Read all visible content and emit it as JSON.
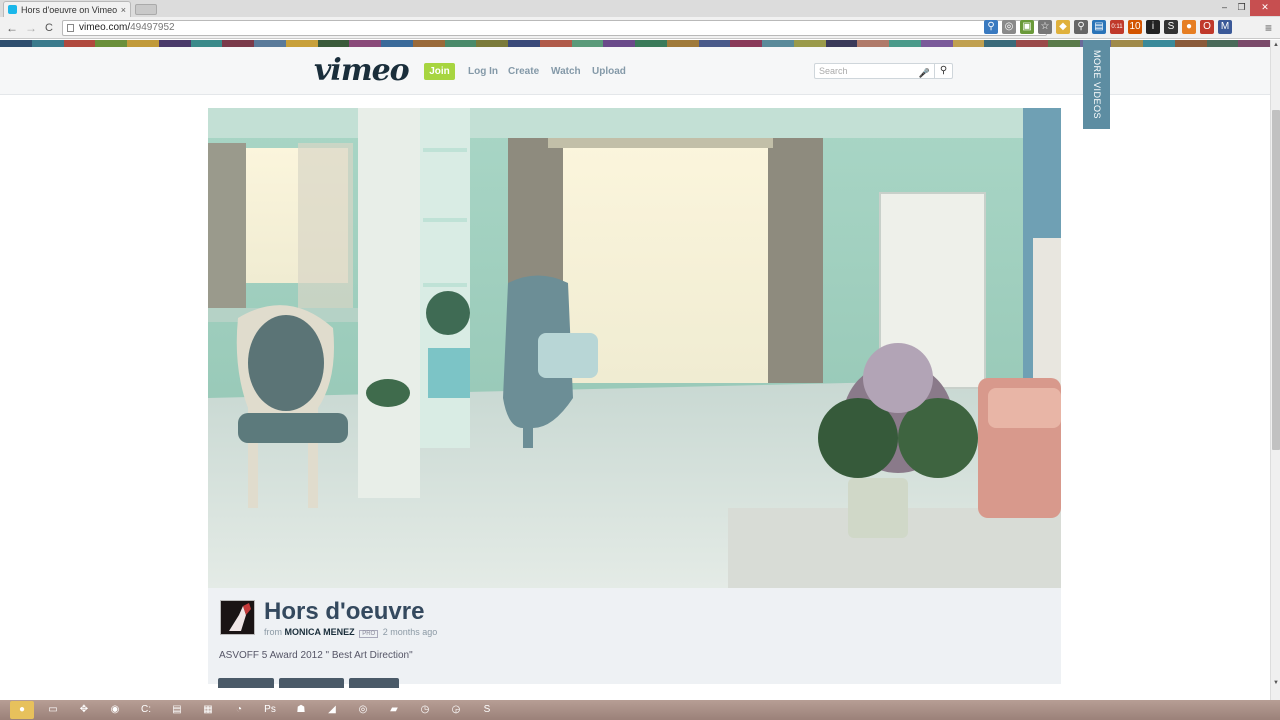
{
  "browser": {
    "tab_title": "Hors d'oeuvre on Vimeo",
    "tab_close": "×",
    "url_host": "vimeo.com/",
    "url_path": "49497952",
    "back": "←",
    "forward": "→",
    "reload": "C",
    "menu": "≡",
    "window": {
      "minimize": "–",
      "restore": "❐",
      "close": "✕"
    },
    "extensions": [
      {
        "name": "translate-icon",
        "glyph": "⚲",
        "color": "#3a7ac0"
      },
      {
        "name": "page-action-icon",
        "glyph": "◎",
        "color": "#8a8a8a"
      },
      {
        "name": "cast-icon",
        "glyph": "▣",
        "color": "#6a9a3a"
      },
      {
        "name": "bookmark-star-icon",
        "glyph": "☆",
        "color": "#777777"
      },
      {
        "name": "ext-folder-icon",
        "glyph": "◆",
        "color": "#e0b13c"
      },
      {
        "name": "ext-search-icon",
        "glyph": "⚲",
        "color": "#666666"
      },
      {
        "name": "ext-screen-icon",
        "glyph": "▤",
        "color": "#2a74b8"
      },
      {
        "name": "ext-counter-icon",
        "glyph": "0:11",
        "color": "#c0392b"
      },
      {
        "name": "ext-badge-icon",
        "glyph": "10",
        "color": "#d35400"
      },
      {
        "name": "ext-info-icon",
        "glyph": "i",
        "color": "#222222"
      },
      {
        "name": "ext-s-icon",
        "glyph": "S",
        "color": "#333333"
      },
      {
        "name": "ext-cookie-icon",
        "glyph": "●",
        "color": "#e67e22"
      },
      {
        "name": "ext-opera-icon",
        "glyph": "O",
        "color": "#c0392b"
      },
      {
        "name": "gmail-icon",
        "glyph": "M",
        "color": "#3b5998"
      }
    ]
  },
  "stripe_colors": [
    "#2e4e6e",
    "#3a7a8c",
    "#b0493e",
    "#6a8f3a",
    "#c19a3a",
    "#4a3a6a",
    "#3a8a8a",
    "#7a3a4a",
    "#5a7a9a",
    "#c8a03a",
    "#3a5a3a",
    "#8a4a7a",
    "#3a6a9a",
    "#9a6a3a",
    "#4a8a6a",
    "#7a7a3a",
    "#3a4a7a",
    "#b05a4a",
    "#5a9a7a",
    "#6a4a8a",
    "#3a7a5a",
    "#a07a3a",
    "#4a5a8a",
    "#8a3a5a",
    "#5a8a9a",
    "#9a9a4a",
    "#3a3a5a",
    "#b07a6a",
    "#4a9a8a",
    "#7a5a9a",
    "#c0a050",
    "#3a6a7a",
    "#9a4a4a",
    "#5a7a4a",
    "#6a6a9a",
    "#a08a4a",
    "#3a8a9a",
    "#8a5a3a",
    "#4a6a5a",
    "#7a4a6a"
  ],
  "header": {
    "logo": "vimeo",
    "join": "Join",
    "nav": [
      "Log In",
      "Create",
      "Watch",
      "Upload"
    ],
    "search_placeholder": "Search",
    "mic": "🎤",
    "search_icon": "⚲"
  },
  "more_videos": "MORE VIDEOS",
  "video": {
    "title": "Hors d'oeuvre",
    "from": "from",
    "author": "MONICA MENEZ",
    "pro": "PRO",
    "time_ago": "2 months ago",
    "description": "ASVOFF 5 Award 2012 \" Best Art Direction\""
  },
  "taskbar": [
    {
      "name": "start-button",
      "glyph": "●"
    },
    {
      "name": "explorer-task",
      "glyph": "▭"
    },
    {
      "name": "app-task-1",
      "glyph": "✥"
    },
    {
      "name": "app-task-2",
      "glyph": "◉"
    },
    {
      "name": "cmd-task",
      "glyph": "C:"
    },
    {
      "name": "notes-task",
      "glyph": "▤"
    },
    {
      "name": "doc-task",
      "glyph": "▦"
    },
    {
      "name": "browser-task",
      "glyph": "◔"
    },
    {
      "name": "photoshop-task",
      "glyph": "Ps"
    },
    {
      "name": "robot-task",
      "glyph": "☗"
    },
    {
      "name": "player-task",
      "glyph": "◢"
    },
    {
      "name": "chrome-task",
      "glyph": "◎"
    },
    {
      "name": "folder-task",
      "glyph": "▰"
    },
    {
      "name": "clock-task",
      "glyph": "◷"
    },
    {
      "name": "timer-task",
      "glyph": "◶"
    },
    {
      "name": "skype-task",
      "glyph": "S"
    }
  ]
}
